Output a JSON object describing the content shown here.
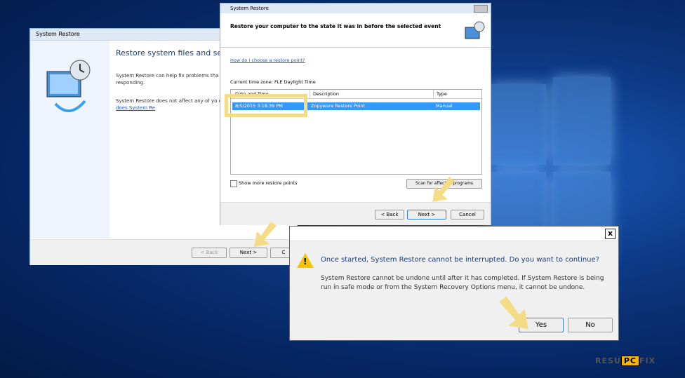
{
  "window_back": {
    "title": "System Restore",
    "heading": "Restore system files and setti",
    "para1": "System Restore can help fix problems tha computer run slowly or stop responding.",
    "para2_text": "System Restore does not affect any of yo other personal data.",
    "para2_link": "How does System Re",
    "back_label": "< Back",
    "next_label": "Next >",
    "cancel_label": "C"
  },
  "window_mid": {
    "title": "System Restore",
    "heading": "Restore your computer to the state it was in before the selected event",
    "help_link": "How do I choose a restore point?",
    "timezone": "Current time zone: FLE Daylight Time",
    "columns": [
      "Date and Time",
      "Description",
      "Type"
    ],
    "rows": [
      {
        "date": "8/5/2015 3:18:39 PM",
        "description": "Zopyware Restore Point",
        "type": "Manual"
      }
    ],
    "show_more_label": "Show more restore points",
    "scan_label": "Scan for affected programs",
    "back_label": "< Back",
    "next_label": "Next >",
    "cancel_label": "Cancel"
  },
  "dialog": {
    "close_glyph": "x",
    "warning_glyph": "!",
    "message": "Once started, System Restore cannot be interrupted. Do you want to continue?",
    "detail": "System Restore cannot be undone until after it has completed. If System Restore is being run in safe mode or from the System Recovery Options menu, it cannot be undone.",
    "yes_label": "Yes",
    "no_label": "No"
  },
  "watermark": {
    "left": "RESU",
    "pc": "PC",
    "right": "FIX"
  },
  "colors": {
    "highlight": "#f4dc86",
    "selection": "#3399ff",
    "desktop": "#0d3a86"
  }
}
